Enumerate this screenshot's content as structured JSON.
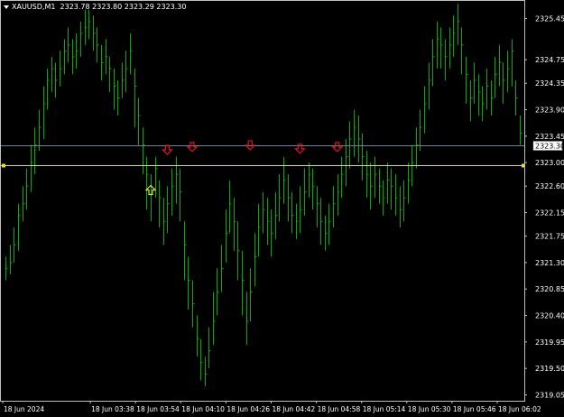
{
  "header": {
    "symbol": "XAUUSD,M1",
    "ohlc": "2323.78 2323.80 2323.29 2323.30"
  },
  "colors": {
    "background": "#000000",
    "frame": "#c0c0c0",
    "bar": "#00b000",
    "current_price_line": "#6b82a0",
    "horizontal_line": "#e0e040",
    "arrow_down": "#e01818",
    "arrow_up": "#e0e040",
    "price_label_bg": "#ffffff",
    "axis_text": "#ffffff"
  },
  "chart_data": {
    "type": "ohlc-bar",
    "symbol": "XAUUSD",
    "timeframe": "M1",
    "y_ticks": [
      2325.45,
      2324.75,
      2324.35,
      2323.9,
      2323.45,
      2323.0,
      2322.6,
      2322.15,
      2321.75,
      2321.3,
      2320.85,
      2320.4,
      2319.95,
      2319.5,
      2319.05
    ],
    "x_ticks": [
      "18 Jun 2024",
      "18 Jun 03:38",
      "18 Jun 03:54",
      "18 Jun 04:10",
      "18 Jun 04:26",
      "18 Jun 04:42",
      "18 Jun 04:58",
      "18 Jun 05:14",
      "18 Jun 05:30",
      "18 Jun 05:46",
      "18 Jun 06:02"
    ],
    "current_price": 2323.3,
    "current_price_label": "2323.30",
    "horizontal_line_price": 2322.95,
    "ylim": [
      2318.95,
      2325.75
    ],
    "bars": [
      [
        2321.2,
        2321.0,
        2321.4
      ],
      [
        2321.3,
        2321.1,
        2321.6
      ],
      [
        2321.6,
        2321.3,
        2321.9
      ],
      [
        2322.1,
        2321.5,
        2322.3
      ],
      [
        2322.3,
        2322.0,
        2322.6
      ],
      [
        2322.6,
        2322.2,
        2322.9
      ],
      [
        2323.0,
        2322.5,
        2323.3
      ],
      [
        2323.3,
        2322.8,
        2323.6
      ],
      [
        2323.6,
        2323.2,
        2323.9
      ],
      [
        2324.0,
        2323.4,
        2324.3
      ],
      [
        2324.4,
        2323.9,
        2324.6
      ],
      [
        2324.6,
        2324.2,
        2324.8
      ],
      [
        2324.4,
        2324.1,
        2324.7
      ],
      [
        2324.6,
        2324.3,
        2324.9
      ],
      [
        2324.9,
        2324.5,
        2325.1
      ],
      [
        2325.0,
        2324.7,
        2325.3
      ],
      [
        2324.8,
        2324.5,
        2325.1
      ],
      [
        2324.9,
        2324.6,
        2325.2
      ],
      [
        2325.2,
        2324.8,
        2325.4
      ],
      [
        2325.3,
        2325.0,
        2325.6
      ],
      [
        2325.4,
        2325.1,
        2325.6
      ],
      [
        2325.2,
        2324.9,
        2325.5
      ],
      [
        2325.0,
        2324.7,
        2325.3
      ],
      [
        2324.7,
        2324.4,
        2325.0
      ],
      [
        2324.8,
        2324.5,
        2325.1
      ],
      [
        2324.6,
        2324.2,
        2324.8
      ],
      [
        2324.3,
        2323.9,
        2324.6
      ],
      [
        2324.1,
        2323.8,
        2324.4
      ],
      [
        2324.4,
        2324.1,
        2324.7
      ],
      [
        2324.6,
        2324.2,
        2324.9
      ],
      [
        2324.9,
        2324.5,
        2325.2
      ],
      [
        2324.3,
        2323.6,
        2324.6
      ],
      [
        2323.8,
        2323.3,
        2324.1
      ],
      [
        2323.3,
        2322.8,
        2323.6
      ],
      [
        2322.8,
        2322.2,
        2323.1
      ],
      [
        2322.5,
        2322.0,
        2322.8
      ],
      [
        2322.9,
        2322.4,
        2323.1
      ],
      [
        2322.4,
        2321.9,
        2322.7
      ],
      [
        2322.0,
        2321.6,
        2322.4
      ],
      [
        2322.3,
        2321.8,
        2322.6
      ],
      [
        2322.6,
        2322.1,
        2322.9
      ],
      [
        2322.8,
        2322.3,
        2323.1
      ],
      [
        2322.5,
        2322.0,
        2322.9
      ],
      [
        2321.6,
        2321.0,
        2322.0
      ],
      [
        2321.0,
        2320.5,
        2321.4
      ],
      [
        2320.6,
        2320.2,
        2321.0
      ],
      [
        2320.0,
        2319.7,
        2320.4
      ],
      [
        2319.6,
        2319.3,
        2320.0
      ],
      [
        2319.4,
        2319.2,
        2319.7
      ],
      [
        2319.8,
        2319.5,
        2320.2
      ],
      [
        2320.3,
        2319.9,
        2320.8
      ],
      [
        2320.8,
        2320.4,
        2321.2
      ],
      [
        2321.2,
        2320.8,
        2321.6
      ],
      [
        2321.8,
        2321.3,
        2322.2
      ],
      [
        2322.3,
        2321.8,
        2322.7
      ],
      [
        2322.0,
        2321.5,
        2322.4
      ],
      [
        2321.5,
        2321.0,
        2322.0
      ],
      [
        2321.0,
        2320.4,
        2321.5
      ],
      [
        2320.3,
        2319.9,
        2320.8
      ],
      [
        2320.8,
        2320.3,
        2321.2
      ],
      [
        2321.4,
        2320.9,
        2321.8
      ],
      [
        2321.9,
        2321.4,
        2322.3
      ],
      [
        2322.2,
        2321.8,
        2322.5
      ],
      [
        2322.0,
        2321.6,
        2322.4
      ],
      [
        2321.8,
        2321.4,
        2322.2
      ],
      [
        2322.1,
        2321.7,
        2322.5
      ],
      [
        2322.4,
        2322.0,
        2322.8
      ],
      [
        2322.7,
        2322.3,
        2323.1
      ],
      [
        2322.4,
        2322.0,
        2322.8
      ],
      [
        2322.1,
        2321.8,
        2322.5
      ],
      [
        2322.0,
        2321.7,
        2322.3
      ],
      [
        2322.2,
        2321.8,
        2322.6
      ],
      [
        2322.5,
        2322.1,
        2322.9
      ],
      [
        2322.8,
        2322.4,
        2323.0
      ],
      [
        2322.6,
        2322.2,
        2322.9
      ],
      [
        2322.3,
        2321.9,
        2322.6
      ],
      [
        2322.0,
        2321.6,
        2322.4
      ],
      [
        2321.8,
        2321.5,
        2322.1
      ],
      [
        2322.0,
        2321.6,
        2322.3
      ],
      [
        2322.3,
        2321.9,
        2322.6
      ],
      [
        2322.5,
        2322.1,
        2322.8
      ],
      [
        2322.8,
        2322.4,
        2323.1
      ],
      [
        2323.1,
        2322.6,
        2323.4
      ],
      [
        2323.4,
        2322.9,
        2323.7
      ],
      [
        2323.6,
        2323.1,
        2323.9
      ],
      [
        2323.4,
        2323.0,
        2323.8
      ],
      [
        2323.1,
        2322.7,
        2323.5
      ],
      [
        2322.8,
        2322.4,
        2323.2
      ],
      [
        2322.6,
        2322.2,
        2323.0
      ],
      [
        2322.8,
        2322.4,
        2323.1
      ],
      [
        2322.6,
        2322.3,
        2322.9
      ],
      [
        2322.4,
        2322.1,
        2322.7
      ],
      [
        2322.7,
        2322.3,
        2323.0
      ],
      [
        2322.6,
        2322.2,
        2322.9
      ],
      [
        2322.4,
        2322.1,
        2322.8
      ],
      [
        2322.2,
        2321.9,
        2322.6
      ],
      [
        2322.4,
        2322.0,
        2322.7
      ],
      [
        2322.7,
        2322.3,
        2323.0
      ],
      [
        2323.0,
        2322.6,
        2323.3
      ],
      [
        2323.3,
        2322.9,
        2323.6
      ],
      [
        2323.6,
        2323.2,
        2323.9
      ],
      [
        2324.0,
        2323.5,
        2324.3
      ],
      [
        2324.4,
        2323.9,
        2324.7
      ],
      [
        2324.8,
        2324.3,
        2325.1
      ],
      [
        2325.1,
        2324.6,
        2325.4
      ],
      [
        2325.0,
        2324.6,
        2325.3
      ],
      [
        2324.8,
        2324.4,
        2325.1
      ],
      [
        2325.0,
        2324.6,
        2325.3
      ],
      [
        2325.2,
        2324.8,
        2325.5
      ],
      [
        2325.4,
        2325.0,
        2325.7
      ],
      [
        2325.0,
        2324.5,
        2325.3
      ],
      [
        2324.5,
        2324.0,
        2324.8
      ],
      [
        2324.1,
        2323.7,
        2324.4
      ],
      [
        2324.4,
        2324.0,
        2324.7
      ],
      [
        2324.2,
        2323.8,
        2324.5
      ],
      [
        2324.0,
        2323.7,
        2324.3
      ],
      [
        2324.3,
        2323.9,
        2324.6
      ],
      [
        2324.1,
        2323.8,
        2324.4
      ],
      [
        2324.5,
        2324.1,
        2324.8
      ],
      [
        2324.7,
        2324.3,
        2325.0
      ],
      [
        2324.4,
        2324.0,
        2324.7
      ],
      [
        2324.6,
        2324.2,
        2324.9
      ],
      [
        2324.9,
        2324.3,
        2325.1
      ],
      [
        2324.1,
        2323.8,
        2324.4
      ],
      [
        2323.5,
        2323.3,
        2323.8
      ]
    ],
    "markers": [
      {
        "type": "down",
        "bar": 39,
        "price": 2323.2
      },
      {
        "type": "down",
        "bar": 45,
        "price": 2323.25
      },
      {
        "type": "down",
        "bar": 59,
        "price": 2323.28
      },
      {
        "type": "down",
        "bar": 71,
        "price": 2323.22
      },
      {
        "type": "down",
        "bar": 80,
        "price": 2323.25
      },
      {
        "type": "up",
        "bar": 35,
        "price": 2322.55
      }
    ]
  }
}
